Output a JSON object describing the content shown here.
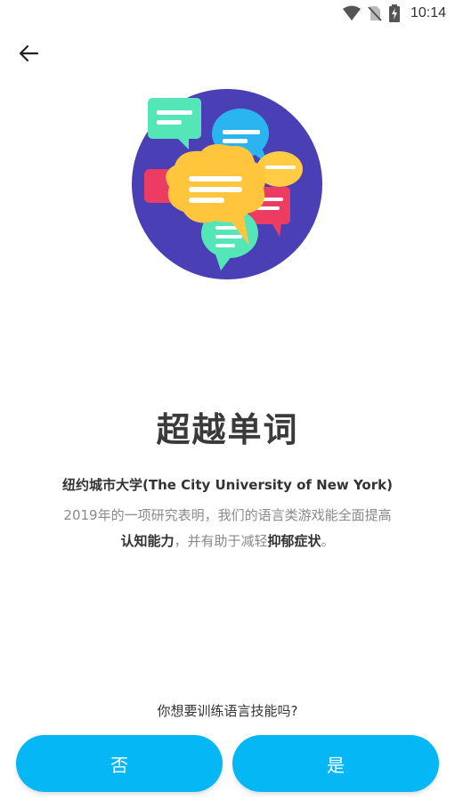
{
  "status_bar": {
    "time": "10:14",
    "icons": [
      "wifi-icon",
      "no-sim-icon",
      "battery-charging-icon"
    ]
  },
  "header": {
    "back_icon": "arrow-left-icon"
  },
  "hero": {
    "icon": "speech-bubbles-illustration"
  },
  "content": {
    "title": "超越单词",
    "source": "纽约城市大学(The City University of New York)",
    "desc_1": "2019年的一项研究表明，我们的语言类游戏能全面提高",
    "desc_bold_1": "认知能力",
    "desc_2": "，并有助于减轻",
    "desc_bold_2": "抑郁症状",
    "desc_3": "。",
    "question": "你想要训练语言技能吗?"
  },
  "buttons": {
    "no_label": "否",
    "yes_label": "是"
  },
  "colors": {
    "accent": "#05b8f5",
    "circle": "#4b3fb5"
  }
}
